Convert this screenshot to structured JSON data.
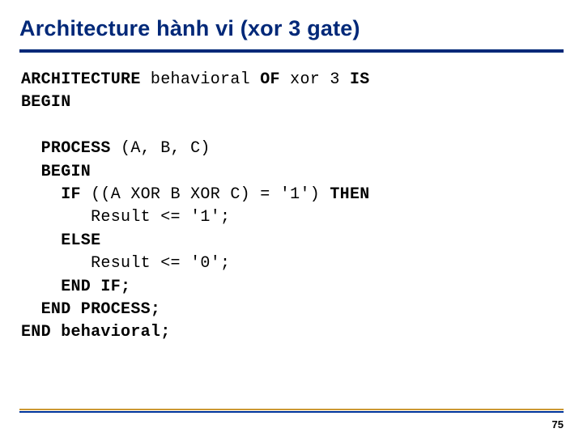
{
  "title": "Architecture hành vi (xor 3 gate)",
  "code": {
    "l1a": "ARCHITECTURE",
    "l1b": " behavioral ",
    "l1c": "OF",
    "l1d": " xor 3 ",
    "l1e": "IS",
    "l2": "BEGIN",
    "l3a": "  PROCESS",
    "l3b": " (A, B, C)",
    "l4": "  BEGIN",
    "l5a": "    IF",
    "l5b": " ((A XOR B XOR C) = '1') ",
    "l5c": "THEN",
    "l6": "       Result <= '1';",
    "l7": "    ELSE",
    "l8": "       Result <= '0';",
    "l9": "    END IF;",
    "l10": "  END PROCESS;",
    "l11": "END behavioral;"
  },
  "page": "75"
}
